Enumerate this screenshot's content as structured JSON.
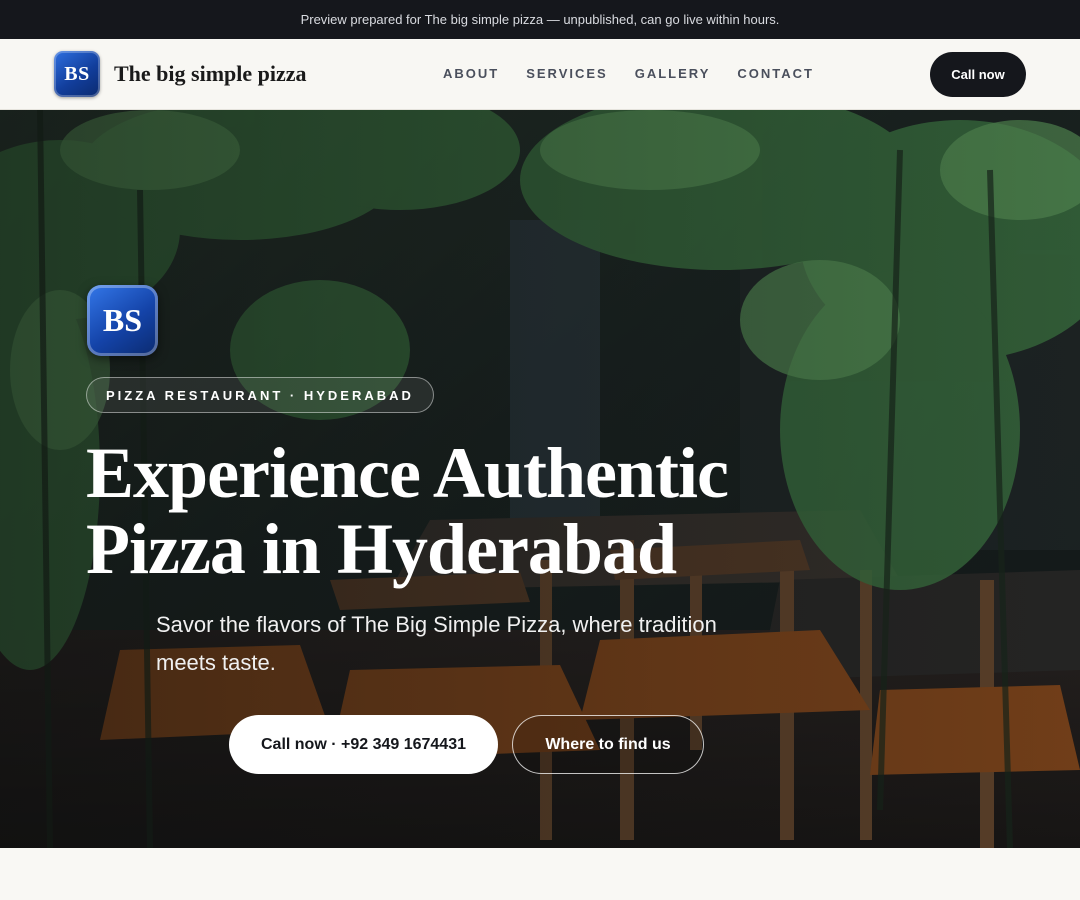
{
  "banner": {
    "text": "Preview prepared for The big simple pizza — unpublished, can go live within hours."
  },
  "header": {
    "logo_text": "BS",
    "brand": "The big simple pizza",
    "nav": [
      {
        "label": "ABOUT"
      },
      {
        "label": "SERVICES"
      },
      {
        "label": "GALLERY"
      },
      {
        "label": "CONTACT"
      }
    ],
    "cta": "Call now"
  },
  "hero": {
    "logo_text": "BS",
    "tag": "PIZZA RESTAURANT · HYDERABAD",
    "title_line1": "Experience Authentic",
    "title_line2": "Pizza in Hyderabad",
    "subtitle": "Savor the flavors of The Big Simple Pizza, where tradition meets taste.",
    "primary_button": "Call now · +92 349 1674431",
    "secondary_button": "Where to find us"
  },
  "colors": {
    "topbar": "#15171c",
    "logo_blue": "#1443a8",
    "cta_dark": "#15171c"
  }
}
